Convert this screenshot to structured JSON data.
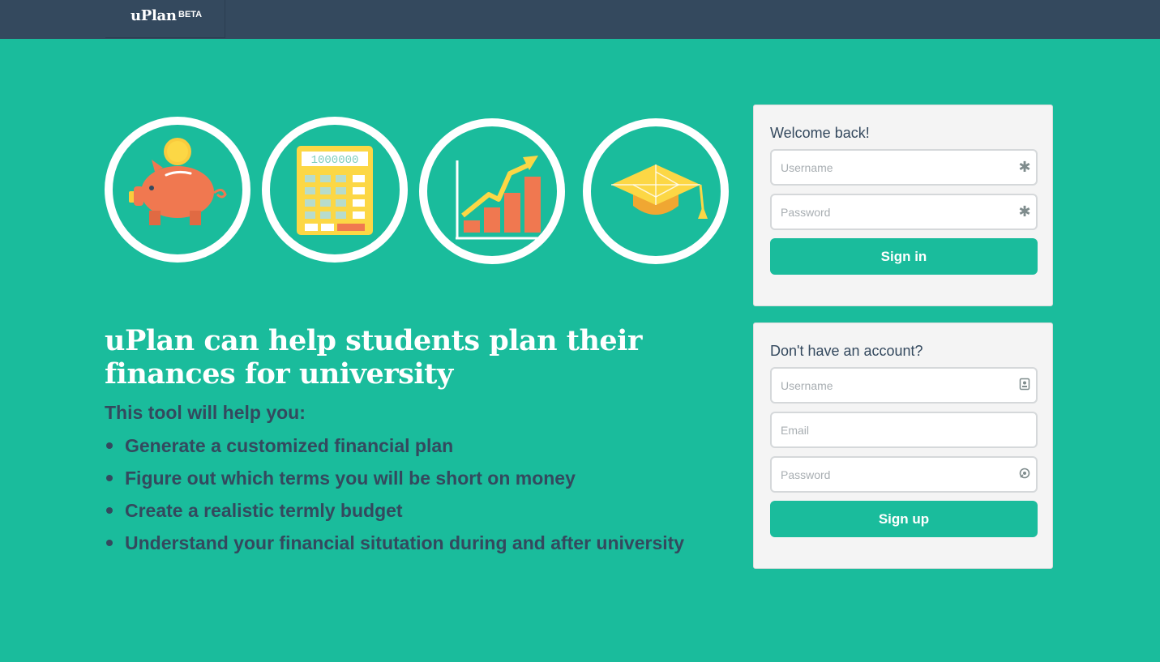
{
  "navbar": {
    "brand": "uPlan",
    "badge": "BETA"
  },
  "feature_icons": [
    {
      "name": "piggy-bank-icon"
    },
    {
      "name": "calculator-icon",
      "display": "1000000"
    },
    {
      "name": "growth-chart-icon"
    },
    {
      "name": "graduation-cap-icon"
    }
  ],
  "hero": {
    "headline": "uPlan can help students plan their finances for university",
    "subhead": "This tool will help you:",
    "features": [
      "Generate a customized financial plan",
      "Figure out which terms you will be short on money",
      "Create a realistic termly budget",
      "Understand your financial situtation during and after university"
    ]
  },
  "signin": {
    "title": "Welcome back!",
    "username_placeholder": "Username",
    "password_placeholder": "Password",
    "submit_label": "Sign in",
    "username_icon": "asterisk-icon",
    "password_icon": "asterisk-icon"
  },
  "signup": {
    "title": "Don't have an account?",
    "username_placeholder": "Username",
    "email_placeholder": "Email",
    "password_placeholder": "Password",
    "submit_label": "Sign up",
    "username_icon": "contact-card-icon",
    "password_icon": "password-reveal-icon"
  },
  "colors": {
    "background": "#1abc9c",
    "navbar": "#34495e",
    "text_dark": "#34495e",
    "button": "#1abc9c",
    "card": "#f4f4f4",
    "coin": "#f9cb3d",
    "pig": "#f07850",
    "calculator": "#fcd745"
  }
}
